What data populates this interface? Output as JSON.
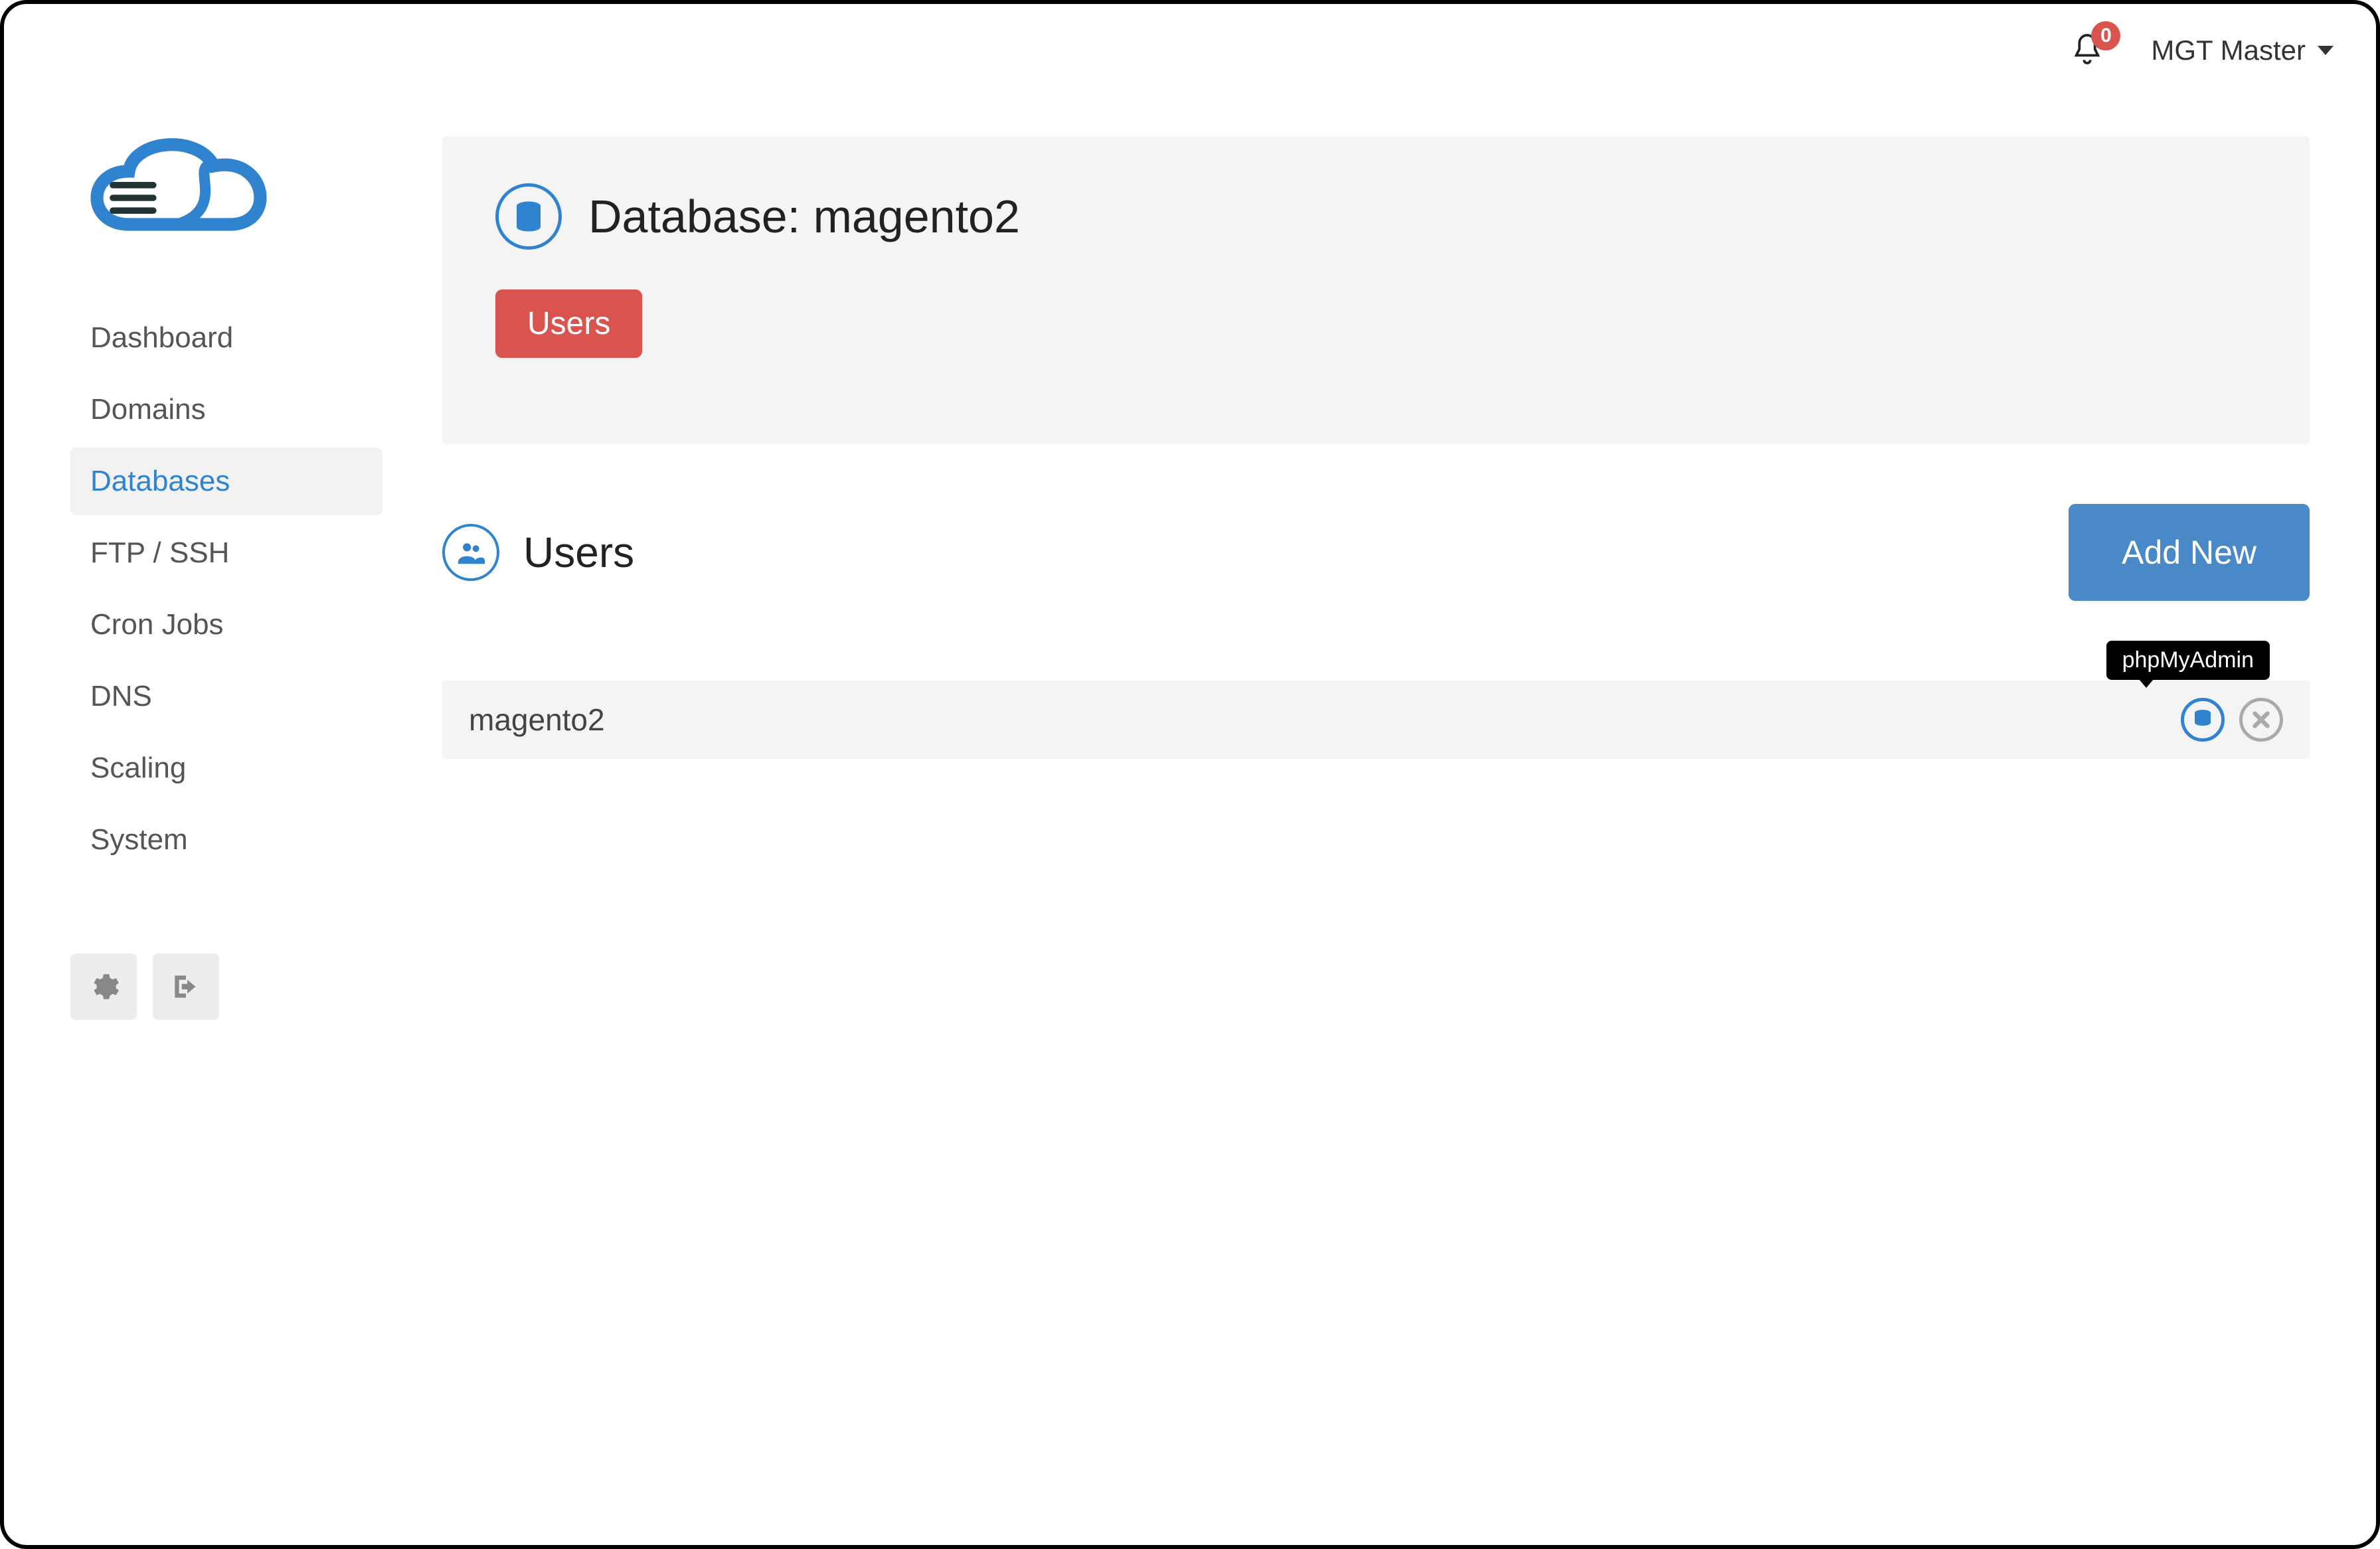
{
  "topbar": {
    "notification_count": "0",
    "user_label": "MGT Master"
  },
  "sidebar": {
    "items": [
      {
        "label": "Dashboard",
        "active": false
      },
      {
        "label": "Domains",
        "active": false
      },
      {
        "label": "Databases",
        "active": true
      },
      {
        "label": "FTP / SSH",
        "active": false
      },
      {
        "label": "Cron Jobs",
        "active": false
      },
      {
        "label": "DNS",
        "active": false
      },
      {
        "label": "Scaling",
        "active": false
      },
      {
        "label": "System",
        "active": false
      }
    ]
  },
  "header": {
    "title_prefix": "Database: ",
    "title_value": "magento2",
    "tab_label": "Users"
  },
  "section": {
    "title": "Users",
    "add_button": "Add New"
  },
  "rows": [
    {
      "name": "magento2",
      "tooltip": "phpMyAdmin"
    }
  ]
}
